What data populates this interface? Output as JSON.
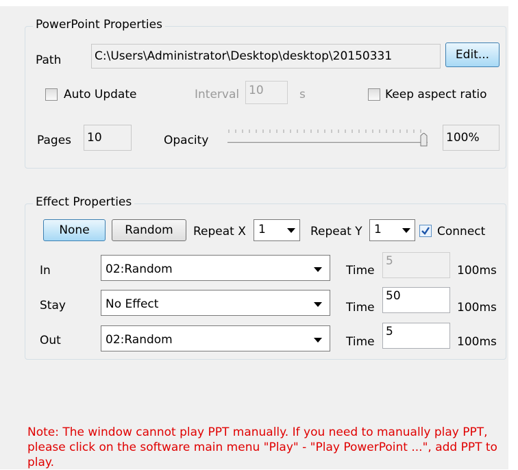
{
  "powerpoint": {
    "legend": "PowerPoint Properties",
    "path_label": "Path",
    "path_value": "C:\\Users\\Administrator\\Desktop\\desktop\\20150331",
    "edit_button": "Edit...",
    "auto_update_label": "Auto Update",
    "auto_update_checked": false,
    "interval_label": "Interval",
    "interval_value": "10",
    "interval_unit": "s",
    "keep_aspect_label": "Keep aspect ratio",
    "keep_aspect_checked": false,
    "pages_label": "Pages",
    "pages_value": "10",
    "opacity_label": "Opacity",
    "opacity_percent": 100,
    "opacity_value": "100%"
  },
  "effect": {
    "legend": "Effect Properties",
    "none_button": "None",
    "random_button": "Random",
    "repeat_x_label": "Repeat X",
    "repeat_x_value": "1",
    "repeat_y_label": "Repeat Y",
    "repeat_y_value": "1",
    "connect_label": "Connect",
    "connect_checked": true,
    "rows": [
      {
        "label": "In",
        "effect": "02:Random",
        "time_label": "Time",
        "time_value": "5",
        "unit": "100ms",
        "time_disabled": true
      },
      {
        "label": "Stay",
        "effect": "No Effect",
        "time_label": "Time",
        "time_value": "50",
        "unit": "100ms",
        "time_disabled": false
      },
      {
        "label": "Out",
        "effect": "02:Random",
        "time_label": "Time",
        "time_value": "5",
        "unit": "100ms",
        "time_disabled": false
      }
    ]
  },
  "note": "Note: The window cannot play PPT manually. If you need to manually play PPT, please click on the software main menu \"Play\" - \"Play PowerPoint ...\", add PPT to play.",
  "colors": {
    "note": "#e00000",
    "panel": "#f0f0f0",
    "accent_button": "#a7d9f5"
  }
}
